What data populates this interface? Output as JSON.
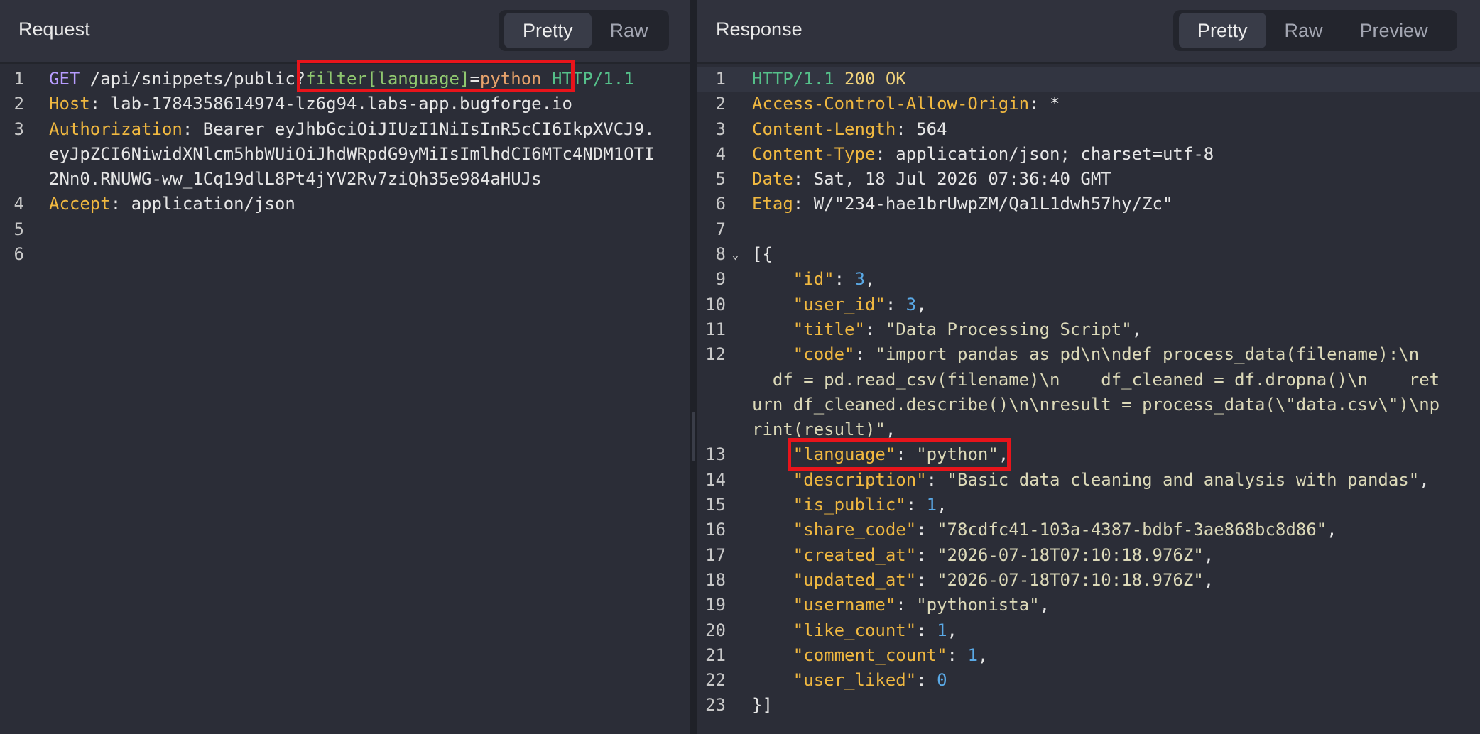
{
  "request": {
    "title": "Request",
    "tabs": [
      "Pretty",
      "Raw"
    ],
    "active_tab": "Pretty",
    "lines": [
      {
        "n": "1",
        "method": "GET",
        "path": " /api/snippets/public",
        "q": "?",
        "param": "filter[language]",
        "eq": "=",
        "val": "python",
        "proto": " HTTP/1.1"
      },
      {
        "n": "2",
        "hname": "Host",
        "hval": ": lab-1784358614974-lz6g94.labs-app.bugforge.io"
      },
      {
        "n": "3",
        "hname": "Authorization",
        "hval": ": Bearer eyJhbGciOiJIUzI1NiIsInR5cCI6IkpXVCJ9."
      },
      {
        "n": "",
        "plain": "eyJpZCI6NiwidXNlcm5hbWUiOiJhdWRpdG9yMiIsImlhdCI6MTc4NDM1OTI"
      },
      {
        "n": "",
        "plain": "2Nn0.RNUWG-ww_1Cq19dlL8Pt4jYV2Rv7ziQh35e984aHUJs"
      },
      {
        "n": "4",
        "hname": "Accept",
        "hval": ": application/json"
      },
      {
        "n": "5"
      },
      {
        "n": "6"
      }
    ]
  },
  "response": {
    "title": "Response",
    "tabs": [
      "Pretty",
      "Raw",
      "Preview"
    ],
    "active_tab": "Pretty",
    "status_line": {
      "n": "1",
      "proto": "HTTP/1.1",
      "code": " 200 OK"
    },
    "headers": [
      {
        "n": "2",
        "name": "Access-Control-Allow-Origin",
        "value": ": *"
      },
      {
        "n": "3",
        "name": "Content-Length",
        "value": ": 564"
      },
      {
        "n": "4",
        "name": "Content-Type",
        "value": ": application/json; charset=utf-8"
      },
      {
        "n": "5",
        "name": "Date",
        "value": ": Sat, 18 Jul 2026 07:36:40 GMT"
      },
      {
        "n": "6",
        "name": "Etag",
        "value": ": W/\"234-hae1brUwpZM/Qa1L1dwh57hy/Zc\""
      }
    ],
    "blank_line": "7",
    "open": {
      "n": "8",
      "text": "[{",
      "fold": "⌄"
    },
    "body": [
      {
        "n": "9",
        "key": "\"id\"",
        "num": "3",
        "comma": ","
      },
      {
        "n": "10",
        "key": "\"user_id\"",
        "num": "3",
        "comma": ","
      },
      {
        "n": "11",
        "key": "\"title\"",
        "str": "\"Data Processing Script\"",
        "comma": ","
      },
      {
        "n": "12",
        "key": "\"code\"",
        "str": "\"import pandas as pd\\n\\ndef process_data(filename):\\n"
      },
      {
        "n": "",
        "cont": "  df = pd.read_csv(filename)\\n    df_cleaned = df.dropna()\\n    ret"
      },
      {
        "n": "",
        "cont": "urn df_cleaned.describe()\\n\\nresult = process_data(\\\"data.csv\\\")\\np"
      },
      {
        "n": "",
        "cont": "rint(result)\"",
        "comma": ","
      },
      {
        "n": "13",
        "key": "\"language\"",
        "str": "\"python\"",
        "comma": ","
      },
      {
        "n": "14",
        "key": "\"description\"",
        "str": "\"Basic data cleaning and analysis with pandas\"",
        "comma": ","
      },
      {
        "n": "15",
        "key": "\"is_public\"",
        "num": "1",
        "comma": ","
      },
      {
        "n": "16",
        "key": "\"share_code\"",
        "str": "\"78cdfc41-103a-4387-bdbf-3ae868bc8d86\"",
        "comma": ","
      },
      {
        "n": "17",
        "key": "\"created_at\"",
        "str": "\"2026-07-18T07:10:18.976Z\"",
        "comma": ","
      },
      {
        "n": "18",
        "key": "\"updated_at\"",
        "str": "\"2026-07-18T07:10:18.976Z\"",
        "comma": ","
      },
      {
        "n": "19",
        "key": "\"username\"",
        "str": "\"pythonista\"",
        "comma": ","
      },
      {
        "n": "20",
        "key": "\"like_count\"",
        "num": "1",
        "comma": ","
      },
      {
        "n": "21",
        "key": "\"comment_count\"",
        "num": "1",
        "comma": ","
      },
      {
        "n": "22",
        "key": "\"user_liked\"",
        "num": "0"
      }
    ],
    "close": {
      "n": "23",
      "text": "}]"
    }
  },
  "colors": {
    "highlight_box": "#e8141b",
    "header_key": "#f0b840",
    "method": "#b79cff",
    "number": "#5aa9e6"
  }
}
